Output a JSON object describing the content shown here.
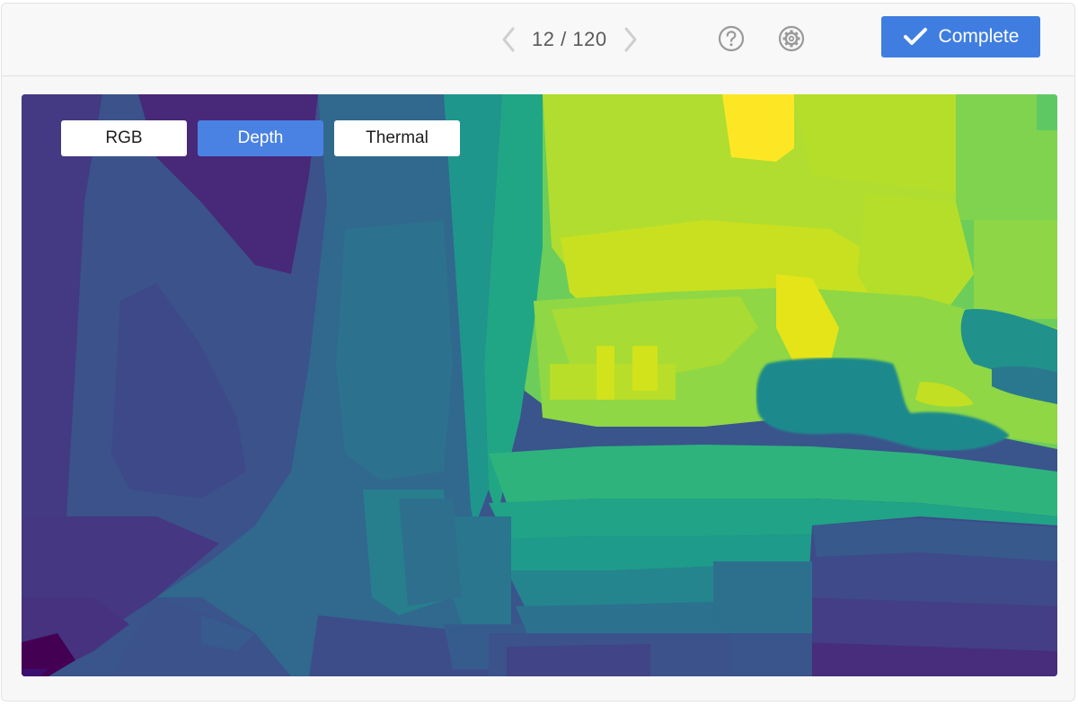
{
  "toolbar": {
    "pager": {
      "current": "12",
      "separator": "/",
      "total": "120"
    },
    "icons": {
      "prev": "chevron-left-icon",
      "next": "chevron-right-icon",
      "help": "help-circle-icon",
      "settings": "gear-icon",
      "complete": "checkmark-icon"
    },
    "complete_label": "Complete"
  },
  "viewer": {
    "modes": [
      {
        "label": "RGB",
        "active": false
      },
      {
        "label": "Depth",
        "active": true
      },
      {
        "label": "Thermal",
        "active": false
      }
    ]
  },
  "colors": {
    "accent": "#3f7ee0",
    "active_mode": "#4a82e3"
  }
}
